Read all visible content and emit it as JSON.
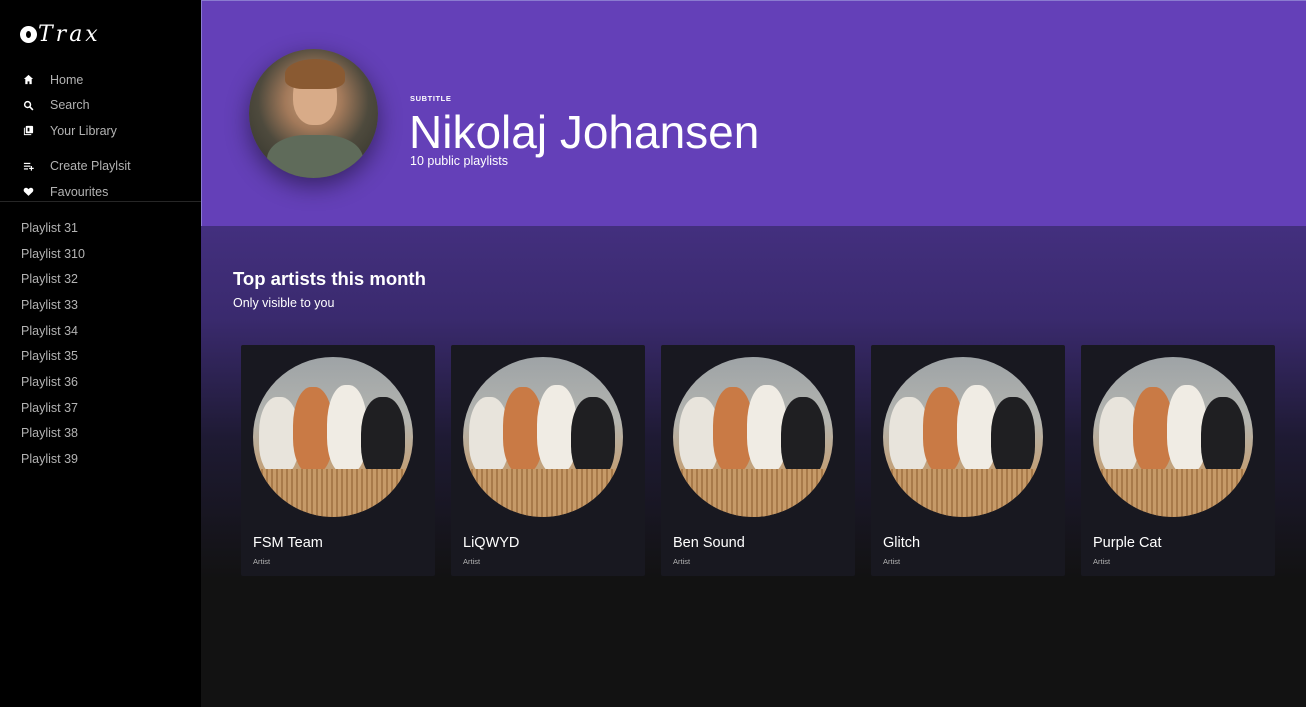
{
  "app": {
    "logo_text": "Trax",
    "logo_icon": "disc-icon"
  },
  "nav": [
    {
      "label": "Home",
      "icon": "home-icon"
    },
    {
      "label": "Search",
      "icon": "search-icon"
    },
    {
      "label": "Your Library",
      "icon": "library-icon"
    },
    {
      "label": "Create Playlsit",
      "icon": "playlist-add-icon"
    },
    {
      "label": "Favourites",
      "icon": "heart-icon"
    }
  ],
  "playlists": [
    "Playlist 31",
    "Playlist 310",
    "Playlist 32",
    "Playlist 33",
    "Playlist 34",
    "Playlist 35",
    "Playlist 36",
    "Playlist 37",
    "Playlist 38",
    "Playlist 39"
  ],
  "header": {
    "subtitle": "SUBTITLE",
    "title": "Nikolaj Johansen",
    "description": "10 public playlists",
    "color": "#6440b8"
  },
  "section": {
    "title": "Top artists this month",
    "subtitle": "Only visible to you"
  },
  "artists": [
    {
      "name": "FSM Team",
      "type": "Artist"
    },
    {
      "name": "LiQWYD",
      "type": "Artist"
    },
    {
      "name": "Ben Sound",
      "type": "Artist"
    },
    {
      "name": "Glitch",
      "type": "Artist"
    },
    {
      "name": "Purple Cat",
      "type": "Artist"
    }
  ]
}
